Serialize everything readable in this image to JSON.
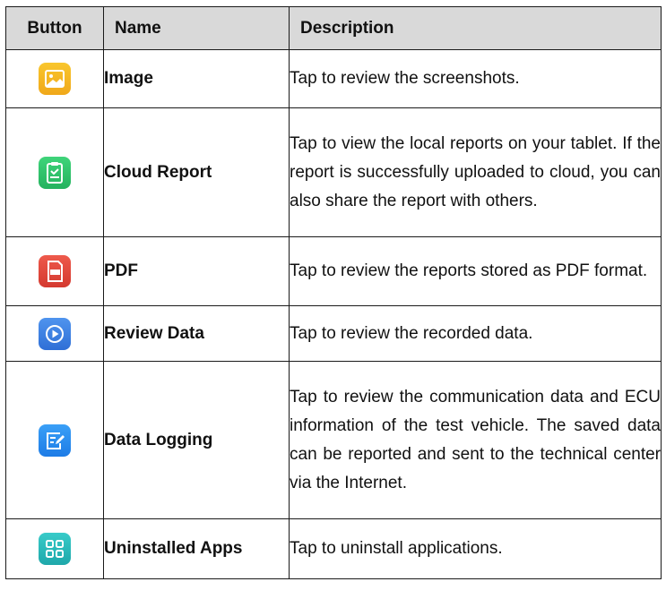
{
  "table": {
    "headers": {
      "button": "Button",
      "name": "Name",
      "description": "Description"
    },
    "rows": [
      {
        "icon": "image-icon",
        "color": "#f5b21a",
        "name": "Image",
        "description": "Tap to review the screenshots."
      },
      {
        "icon": "cloud-report-icon",
        "color": "#2ec46b",
        "name": "Cloud Report",
        "description": "Tap to view the local reports on your tablet. If the report is successfully uploaded to cloud, you can also share the report with others."
      },
      {
        "icon": "pdf-icon",
        "color": "#e0453c",
        "name": "PDF",
        "description": "Tap to review the reports stored as PDF format."
      },
      {
        "icon": "review-data-icon",
        "color": "#3c7fe0",
        "name": "Review Data",
        "description": "Tap to review the recorded data."
      },
      {
        "icon": "data-logging-icon",
        "color": "#2a8ef0",
        "name": "Data Logging",
        "description": "Tap to review the communication data and ECU information of the test vehicle. The saved data can be reported and sent to the technical center via the Internet."
      },
      {
        "icon": "uninstalled-apps-icon",
        "color": "#27b8b8",
        "name": "Uninstalled Apps",
        "description": "Tap to uninstall applications."
      }
    ]
  }
}
